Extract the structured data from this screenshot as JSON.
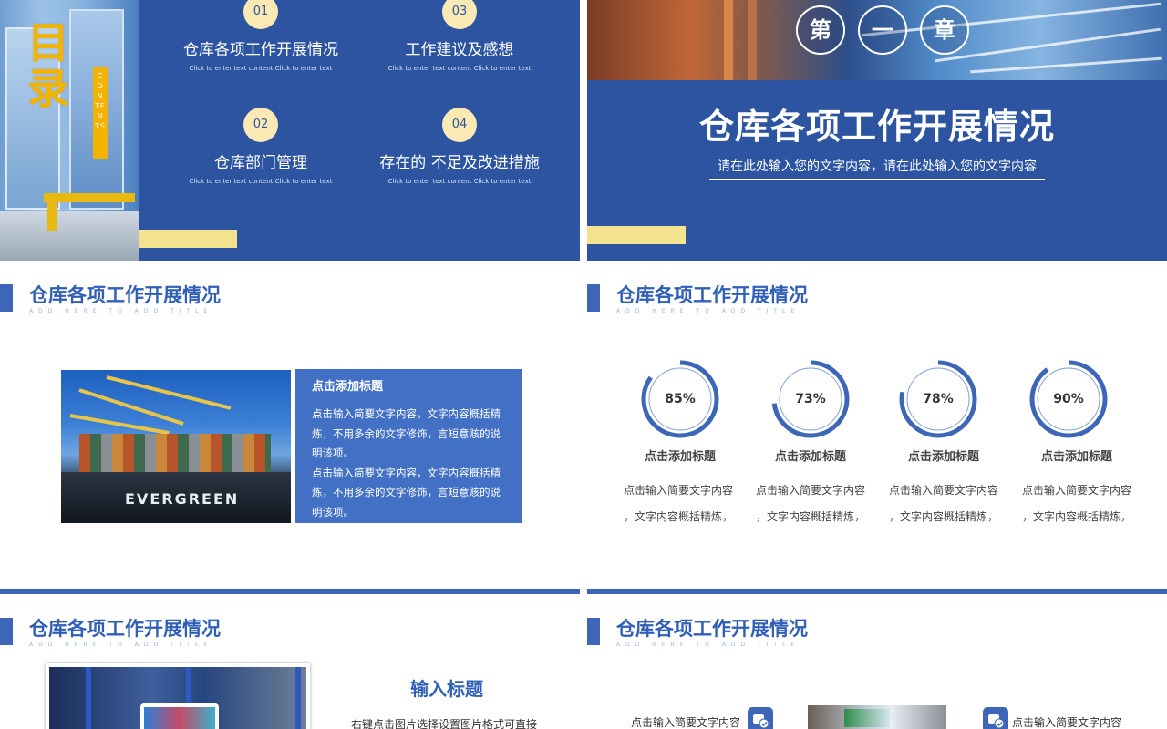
{
  "contents_slide": {
    "title": "目录",
    "contents_label": "CONTENTS",
    "items": [
      {
        "num": "01",
        "label": "仓库各项工作开展情况",
        "sub": "Click to enter text content Click to enter text"
      },
      {
        "num": "03",
        "label": "工作建议及感想",
        "sub": "Click to enter text content Click to enter text"
      },
      {
        "num": "02",
        "label": "仓库部门管理",
        "sub": "Click to enter text content Click to enter text"
      },
      {
        "num": "04",
        "label": "存在的 不足及改进措施",
        "sub": "Click to enter text content Click to enter text"
      }
    ]
  },
  "chapter_slide": {
    "circles": [
      "第",
      "一",
      "章"
    ],
    "title": "仓库各项工作开展情况",
    "subtitle": "请在此处输入您的文字内容，请在此处输入您的文字内容"
  },
  "header": {
    "title": "仓库各项工作开展情况",
    "sub": "ADD HERE TO ADD TITLE"
  },
  "photo_slide": {
    "ship_brand": "EVERGREEN",
    "card_title": "点击添加标题",
    "card_paragraph_1": "点击输入简要文字内容，文字内容概括精炼，不用多余的文字修饰，言短意赅的说明该项。",
    "card_paragraph_2": "点击输入简要文字内容，文字内容概括精炼，不用多余的文字修饰，言短意赅的说明该项。"
  },
  "stats_slide": {
    "items": [
      {
        "value": "85%",
        "progress": 0.85,
        "title": "点击添加标题",
        "desc_1": "点击输入简要文字内容",
        "desc_2": "，文字内容概括精炼，"
      },
      {
        "value": "73%",
        "progress": 0.73,
        "title": "点击添加标题",
        "desc_1": "点击输入简要文字内容",
        "desc_2": "，文字内容概括精炼，"
      },
      {
        "value": "78%",
        "progress": 0.78,
        "title": "点击添加标题",
        "desc_1": "点击输入简要文字内容",
        "desc_2": "，文字内容概括精炼，"
      },
      {
        "value": "90%",
        "progress": 0.9,
        "title": "点击添加标题",
        "desc_1": "点击输入简要文字内容",
        "desc_2": "，文字内容概括精炼，"
      }
    ]
  },
  "input_slide": {
    "title": "输入标题",
    "text": "右键点击图片选择设置图片格式可直接"
  },
  "feature_slide": {
    "left_text": "点击输入简要文字内容",
    "right_text": "点击输入简要文字内容",
    "left_icon": "coins-check-icon",
    "right_icon": "coins-check-icon"
  },
  "colors": {
    "primary": "#2c54a0",
    "accent": "#3d66b8",
    "title_blue": "#2f5fb7",
    "yellow": "#f2b400",
    "pale_yellow": "#f3e28e"
  }
}
